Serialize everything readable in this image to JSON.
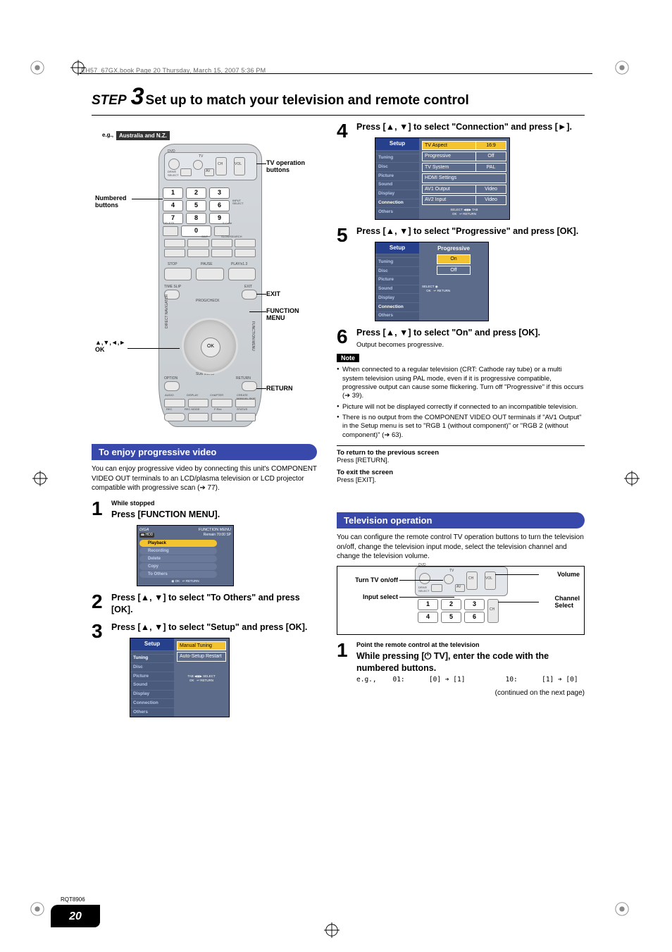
{
  "header_line": "EH57_67GX.book  Page 20  Thursday, March 15, 2007  5:36 PM",
  "title": {
    "step": "STEP",
    "num": "3",
    "text": "Set up to match your television and remote control"
  },
  "remote": {
    "eg_prefix": "e.g.,",
    "eg_label": "Australia and N.Z.",
    "callouts": {
      "tv_operation": "TV operation\nbuttons",
      "numbered": "Numbered\nbuttons",
      "exit": "EXIT",
      "function_menu": "FUNCTION\nMENU",
      "arrows_ok": "▲,▼,◄,►\nOK",
      "return": "RETURN"
    },
    "keypad": [
      "1",
      "2",
      "3",
      "4",
      "5",
      "6",
      "7",
      "8",
      "9",
      "0"
    ],
    "ok": "OK"
  },
  "left": {
    "section_progressive": "To enjoy progressive video",
    "progressive_intro": "You can enjoy progressive video by connecting this unit's COMPONENT VIDEO OUT terminals to an LCD/plasma television or LCD projector compatible with progressive scan (➔ 77).",
    "steps": {
      "s1_sub": "While stopped",
      "s1": "Press [FUNCTION MENU].",
      "s2": "Press [▲, ▼] to select \"To Others\" and press [OK].",
      "s3": "Press [▲, ▼] to select \"Setup\" and press [OK]."
    },
    "function_menu_screen": {
      "title": "FUNCTION MENU",
      "remain": "Remain  70:00 SP",
      "hdd": "HDD",
      "items": [
        "Playback",
        "Recording",
        "Delete",
        "Copy",
        "To Others"
      ],
      "hint_ok": "OK",
      "hint_return": "RETURN"
    },
    "setup_screen": {
      "header": "Setup",
      "side": [
        "Tuning",
        "Disc",
        "Picture",
        "Sound",
        "Display",
        "Connection",
        "Others"
      ],
      "main": [
        "Manual Tuning",
        "Auto-Setup Restart"
      ],
      "hint_tab": "TAB",
      "hint_select": "SELECT",
      "hint_ok": "OK",
      "hint_return": "RETURN"
    }
  },
  "right": {
    "s4": "Press [▲, ▼] to select \"Connection\" and press [►].",
    "s5": "Press [▲, ▼] to select \"Progressive\" and press [OK].",
    "s6": "Press [▲, ▼] to select \"On\" and press [OK].",
    "s6_after": "Output becomes progressive.",
    "connection_screen": {
      "header": "Setup",
      "side": [
        "Tuning",
        "Disc",
        "Picture",
        "Sound",
        "Display",
        "Connection",
        "Others"
      ],
      "fields": [
        {
          "k": "TV Aspect",
          "v": "16:9",
          "sel": true
        },
        {
          "k": "Progressive",
          "v": "Off"
        },
        {
          "k": "TV System",
          "v": "PAL"
        },
        {
          "k": "HDMI Settings",
          "v": ""
        },
        {
          "k": "AV1 Output",
          "v": "Video"
        },
        {
          "k": "AV2 Input",
          "v": "Video"
        }
      ],
      "hint_select": "SELECT",
      "hint_tab": "TAB",
      "hint_ok": "OK",
      "hint_return": "RETURN"
    },
    "progressive_screen": {
      "header": "Setup",
      "side": [
        "Tuning",
        "Disc",
        "Picture",
        "Sound",
        "Display",
        "Connection",
        "Others"
      ],
      "title": "Progressive",
      "on": "On",
      "off": "Off",
      "hint_select": "SELECT",
      "hint_ok": "OK",
      "hint_return": "RETURN"
    },
    "note_label": "Note",
    "notes": [
      "When connected to a regular television (CRT: Cathode ray tube) or a multi system television using PAL mode, even if it is progressive compatible, progressive output can cause some flickering. Turn off \"Progressive\" if this occurs (➔ 39).",
      "Picture will not be displayed correctly if connected to an incompatible television.",
      "There is no output from the COMPONENT VIDEO OUT terminals if \"AV1 Output\" in the Setup menu is set to \"RGB 1 (without component)\" or \"RGB 2 (without component)\" (➔ 63)."
    ],
    "return_h": "To return to the previous screen",
    "return_b": "Press [RETURN].",
    "exit_h": "To exit the screen",
    "exit_b": "Press [EXIT].",
    "tv_section": "Television operation",
    "tv_intro": "You can configure the remote control TV operation buttons to turn the television on/off, change the television input mode, select the television channel and change the television volume.",
    "tv_labels": {
      "turn": "Turn TV on/off",
      "input": "Input select",
      "volume": "Volume",
      "channel": "Channel\nSelect"
    },
    "tv_keypad": [
      "1",
      "2",
      "3",
      "4",
      "5",
      "6"
    ],
    "tv_step1_sub": "Point the remote control at the television",
    "tv_step1": "While pressing [⏻ TV], enter the code with the numbered buttons.",
    "tv_example": "e.g.,    01:      [0] ➔ [1]          10:      [1] ➔ [0]",
    "continued": "(continued on the next page)"
  },
  "footer": {
    "rqt": "RQT8906",
    "page": "20"
  }
}
